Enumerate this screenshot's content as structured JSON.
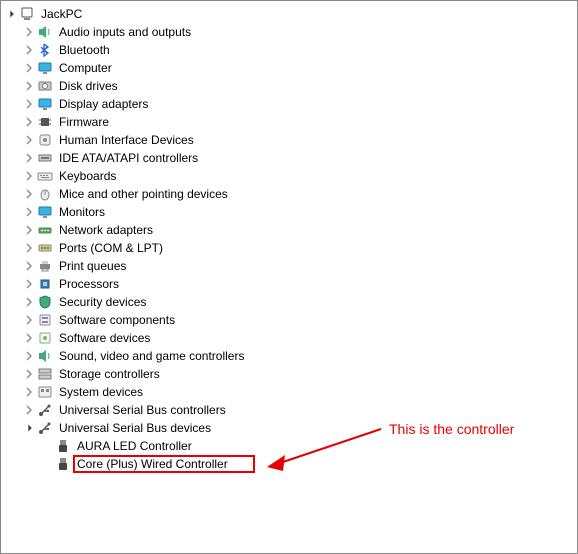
{
  "root": {
    "label": "JackPC"
  },
  "categories": [
    {
      "id": "audio",
      "label": "Audio inputs and outputs",
      "icon": "speaker",
      "expanded": false
    },
    {
      "id": "bluetooth",
      "label": "Bluetooth",
      "icon": "bluetooth",
      "expanded": false
    },
    {
      "id": "computer",
      "label": "Computer",
      "icon": "monitor",
      "expanded": false
    },
    {
      "id": "disk",
      "label": "Disk drives",
      "icon": "drive",
      "expanded": false
    },
    {
      "id": "display",
      "label": "Display adapters",
      "icon": "monitor",
      "expanded": false
    },
    {
      "id": "firmware",
      "label": "Firmware",
      "icon": "chip",
      "expanded": false
    },
    {
      "id": "hid",
      "label": "Human Interface Devices",
      "icon": "hid",
      "expanded": false
    },
    {
      "id": "ide",
      "label": "IDE ATA/ATAPI controllers",
      "icon": "ide",
      "expanded": false
    },
    {
      "id": "keyboard",
      "label": "Keyboards",
      "icon": "keyboard",
      "expanded": false
    },
    {
      "id": "mice",
      "label": "Mice and other pointing devices",
      "icon": "mouse",
      "expanded": false
    },
    {
      "id": "monitors",
      "label": "Monitors",
      "icon": "monitor",
      "expanded": false
    },
    {
      "id": "network",
      "label": "Network adapters",
      "icon": "network",
      "expanded": false
    },
    {
      "id": "ports",
      "label": "Ports (COM & LPT)",
      "icon": "port",
      "expanded": false
    },
    {
      "id": "printq",
      "label": "Print queues",
      "icon": "printer",
      "expanded": false
    },
    {
      "id": "proc",
      "label": "Processors",
      "icon": "cpu",
      "expanded": false
    },
    {
      "id": "security",
      "label": "Security devices",
      "icon": "shield",
      "expanded": false
    },
    {
      "id": "swcomp",
      "label": "Software components",
      "icon": "swcomp",
      "expanded": false
    },
    {
      "id": "swdev",
      "label": "Software devices",
      "icon": "swdev",
      "expanded": false
    },
    {
      "id": "sound",
      "label": "Sound, video and game controllers",
      "icon": "speaker",
      "expanded": false
    },
    {
      "id": "storage",
      "label": "Storage controllers",
      "icon": "storage",
      "expanded": false
    },
    {
      "id": "system",
      "label": "System devices",
      "icon": "system",
      "expanded": false
    },
    {
      "id": "usbctrl",
      "label": "Universal Serial Bus controllers",
      "icon": "usb",
      "expanded": false
    },
    {
      "id": "usbdev",
      "label": "Universal Serial Bus devices",
      "icon": "usb",
      "expanded": true,
      "children": [
        {
          "id": "aura",
          "label": "AURA LED Controller",
          "icon": "usbdevice",
          "highlighted": false
        },
        {
          "id": "core",
          "label": "Core (Plus) Wired Controller",
          "icon": "usbdevice",
          "highlighted": true
        }
      ]
    }
  ],
  "annotation": {
    "text": "This is the controller"
  }
}
